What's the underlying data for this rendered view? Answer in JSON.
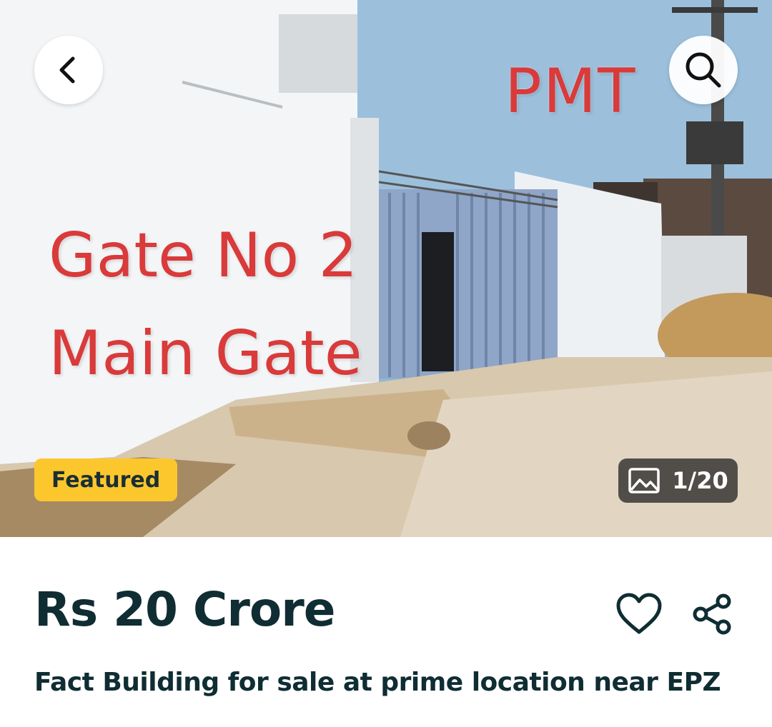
{
  "hero": {
    "overlay_pmt": "PMT",
    "overlay_gate_line1": "Gate No 2",
    "overlay_gate_line2": "Main Gate",
    "badge": "Featured",
    "photo_counter": "1/20",
    "photo_icon": "gallery-icon"
  },
  "header": {
    "back_icon": "chevron-left-icon",
    "search_icon": "search-icon"
  },
  "listing": {
    "price": "Rs 20 Crore",
    "title": "Fact Building for sale at prime location near EPZ",
    "favorite_icon": "heart-icon",
    "share_icon": "share-icon"
  },
  "colors": {
    "primary_text": "#0f2d33",
    "featured_bg": "#fcc72d",
    "overlay_red": "#d93a3a"
  }
}
